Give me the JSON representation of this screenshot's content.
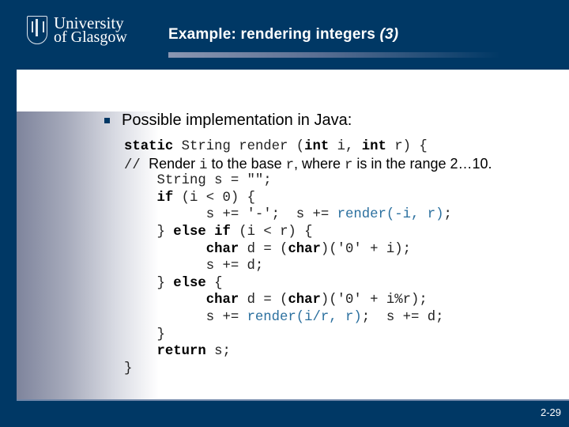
{
  "header": {
    "logo": {
      "line1": "University",
      "line2": "of Glasgow",
      "icon": "university-crest-icon"
    },
    "title": "Example:  rendering integers",
    "title_suffix": "(3)"
  },
  "body": {
    "bullet": "Possible implementation in Java:",
    "code": {
      "l1": {
        "kw1": "static",
        "t1": " String render (",
        "kw2": "int",
        "t2": " i, ",
        "kw3": "int",
        "t3": " r) {"
      },
      "l2": {
        "slashes": "// ",
        "c1": "Render ",
        "v1": "i",
        "c2": " to the base ",
        "v2": "r",
        "c3": ", where ",
        "v3": "r",
        "c4": " is in the range 2…10."
      },
      "l3": {
        "t": "    String s = \"\";"
      },
      "l4": {
        "pre": "    ",
        "kw": "if",
        "t": " (i < 0) {"
      },
      "l5": {
        "t1": "          s += '-';  s += ",
        "call": "render(-i, r)",
        "t2": ";"
      },
      "l6": {
        "t1": "    } ",
        "kw1": "else",
        "sp": " ",
        "kw2": "if",
        "t2": " (i < r) {"
      },
      "l7": {
        "pre": "          ",
        "kw1": "char",
        "t1": " d = (",
        "kw2": "char",
        "t2": ")('0' + i);"
      },
      "l8": {
        "t": "          s += d;"
      },
      "l9": {
        "t1": "    } ",
        "kw": "else",
        "t2": " {"
      },
      "l10": {
        "pre": "          ",
        "kw1": "char",
        "t1": " d = (",
        "kw2": "char",
        "t2": ")('0' + i%r);"
      },
      "l11": {
        "t1": "          s += ",
        "call": "render(i/r, r)",
        "t2": ";  s += d;"
      },
      "l12": {
        "t": "    }"
      },
      "l13": {
        "pre": "    ",
        "kw": "return",
        "t": " s;"
      },
      "l14": {
        "t": "}"
      }
    }
  },
  "footer": {
    "page": "2-29"
  }
}
